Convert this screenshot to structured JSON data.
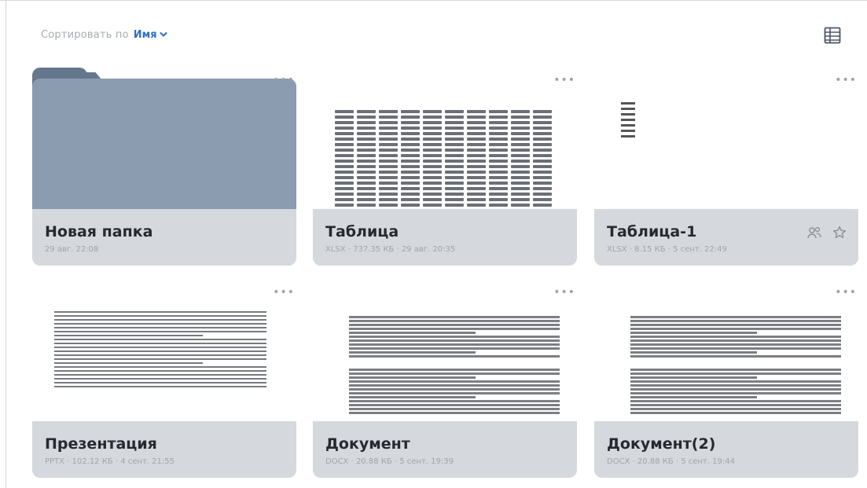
{
  "toolbar": {
    "sort_label": "Сортировать по",
    "sort_value": "Имя"
  },
  "colors": {
    "accent": "#2f6fc6",
    "folder": "#8b9bb0",
    "folder_tab": "#65778d",
    "card_footer": "#d5d8dd"
  },
  "icons": {
    "view_toggle": "table-view-icon",
    "more": "more-icon",
    "share": "share-users-icon",
    "favorite": "star-icon",
    "sort_dropdown": "chevron-down-icon"
  },
  "items": [
    {
      "title": "Новая папка",
      "meta": "29 авг. 22:08",
      "type": "folder",
      "more": "•••"
    },
    {
      "title": "Таблица",
      "meta": "XLSX · 737.35 КБ · 29 авг. 20:35",
      "type": "xlsx",
      "more": "•••"
    },
    {
      "title": "Таблица-1",
      "meta": "XLSX · 8.15 КБ · 5 сент. 22:49",
      "type": "xlsx",
      "more": "•••"
    },
    {
      "title": "Презентация",
      "meta": "PPTX · 102.12 КБ · 4 сент. 21:55",
      "type": "pptx",
      "more": "•••"
    },
    {
      "title": "Документ",
      "meta": "DOCX · 20.88 КБ · 5 сент. 19:39",
      "type": "docx",
      "more": "•••"
    },
    {
      "title": "Документ(2)",
      "meta": "DOCX · 20.88 КБ · 5 сент. 19:44",
      "type": "docx",
      "more": "•••"
    }
  ]
}
